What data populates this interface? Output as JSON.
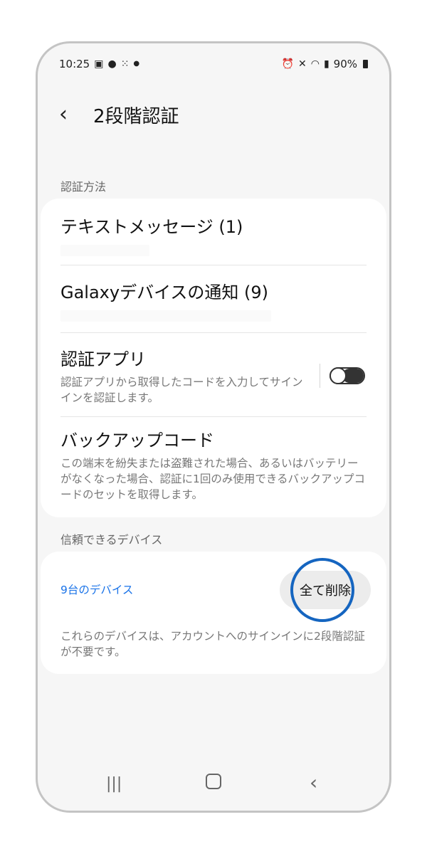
{
  "status_bar": {
    "time": "10:25",
    "left_icons": [
      "image-icon",
      "messenger-icon",
      "apps-icon",
      "dot-icon"
    ],
    "right_icons": [
      "alarm-icon",
      "mute-icon",
      "wifi-icon",
      "signal-icon"
    ],
    "battery": "90%"
  },
  "header": {
    "title": "2段階認証"
  },
  "methods": {
    "section_label": "認証方法",
    "items": [
      {
        "title": "テキストメッセージ (1)"
      },
      {
        "title": "Galaxyデバイスの通知 (9)"
      },
      {
        "title": "認証アプリ",
        "description": "認証アプリから取得したコードを入力してサインインを認証します。",
        "toggle": "off"
      },
      {
        "title": "バックアップコード",
        "description": "この端末を紛失または盗難された場合、あるいはバッテリーがなくなった場合、認証に1回のみ使用できるバックアップコードのセットを取得します。"
      }
    ]
  },
  "trusted": {
    "section_label": "信頼できるデバイス",
    "devices_link": "9台のデバイス",
    "delete_all_button": "全て削除",
    "description": "これらのデバイスは、アカウントへのサインインに2段階認証が不要です。"
  },
  "colors": {
    "link": "#1a73e8",
    "highlight": "#1565c0"
  }
}
